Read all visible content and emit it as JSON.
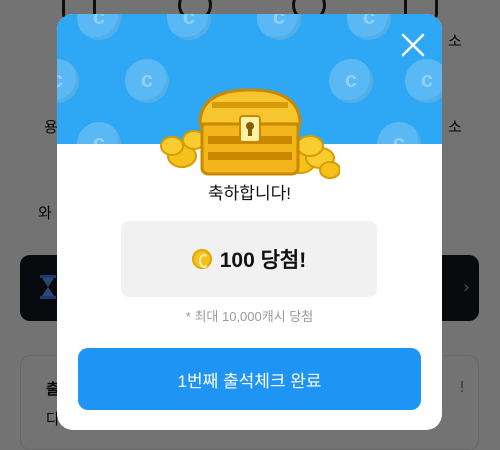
{
  "background": {
    "row1_left": "",
    "row1_right": "소",
    "row2_left": "용",
    "row2_right": "소",
    "row3_left": "와",
    "card_right": "!",
    "card_left_title": "출",
    "card_left_sub": "다"
  },
  "modal": {
    "title": "축하합니다!",
    "reward_text": "100 당첨!",
    "note": "* 최대 10,000캐시 당첨",
    "cta_label": "1번째 출석체크 완료",
    "icons": {
      "close": "close-icon",
      "chest": "treasure-chest-icon",
      "coin": "coin-icon"
    },
    "colors": {
      "header_bg": "#2ea8f5",
      "cta_bg": "#1e95f5",
      "reward_box_bg": "#f1f1f1"
    }
  }
}
